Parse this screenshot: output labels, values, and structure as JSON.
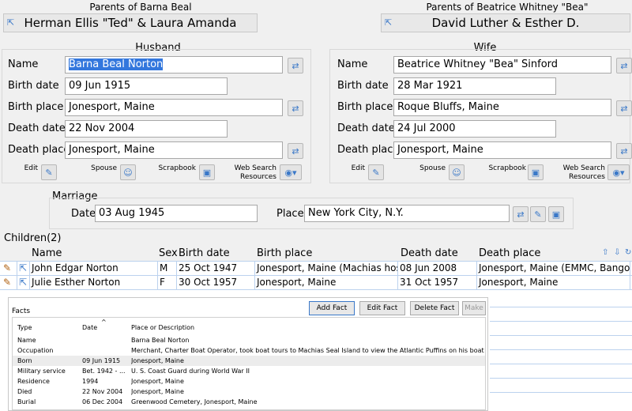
{
  "husband_parents": {
    "caption": "Parents of Barna Beal",
    "name": "Herman Ellis \"Ted\" & Laura Amanda"
  },
  "wife_parents": {
    "caption": "Parents of Beatrice Whitney \"Bea\"",
    "name": "David Luther & Esther D."
  },
  "husband": {
    "title": "Husband",
    "name_label": "Name",
    "name": "Barna Beal Norton",
    "birth_date_label": "Birth date",
    "birth_date": "09 Jun 1915",
    "birth_place_label": "Birth place",
    "birth_place": "Jonesport, Maine",
    "death_date_label": "Death date",
    "death_date": "22 Nov 2004",
    "death_place_label": "Death place",
    "death_place": "Jonesport, Maine",
    "edit_label": "Edit",
    "spouse_label": "Spouse",
    "scrapbook_label": "Scrapbook",
    "web_search_label_1": "Web Search",
    "web_search_label_2": "Resources"
  },
  "wife": {
    "title": "Wife",
    "name_label": "Name",
    "name": "Beatrice Whitney \"Bea\" Sinford",
    "birth_date_label": "Birth date",
    "birth_date": "28 Mar 1921",
    "birth_place_label": "Birth place",
    "birth_place": "Roque Bluffs, Maine",
    "death_date_label": "Death date",
    "death_date": "24 Jul 2000",
    "death_place_label": "Death place",
    "death_place": "Jonesport, Maine",
    "edit_label": "Edit",
    "spouse_label": "Spouse",
    "scrapbook_label": "Scrapbook",
    "web_search_label_1": "Web Search",
    "web_search_label_2": "Resources"
  },
  "marriage": {
    "title": "Marriage",
    "date_label": "Date",
    "date": "03 Aug 1945",
    "place_label": "Place",
    "place": "New York City, N.Y."
  },
  "children": {
    "title": "Children(2)",
    "columns": {
      "name": "Name",
      "sex": "Sex",
      "birth_date": "Birth date",
      "birth_place": "Birth place",
      "death_date": "Death date",
      "death_place": "Death place"
    },
    "rows": [
      {
        "name": "John Edgar Norton",
        "sex": "M",
        "birth_date": "25 Oct 1947",
        "birth_place": "Jonesport, Maine (Machias hospi",
        "death_date": "08 Jun 2008",
        "death_place": "Jonesport, Maine  (EMMC, Bangor)"
      },
      {
        "name": "Julie Esther Norton",
        "sex": "F",
        "birth_date": "30 Oct 1957",
        "birth_place": "Jonesport, Maine",
        "death_date": "31 Oct 1957",
        "death_place": "Jonesport, Maine"
      }
    ]
  },
  "facts": {
    "title": "Facts",
    "buttons": {
      "add": "Add Fact",
      "edit": "Edit Fact",
      "delete": "Delete Fact",
      "make": "Make"
    },
    "columns": {
      "type": "Type",
      "date": "Date",
      "place": "Place or Description"
    },
    "rows": [
      {
        "type": "Name",
        "date": "",
        "place": "Barna Beal Norton"
      },
      {
        "type": "Occupation",
        "date": "",
        "place": "Merchant, Charter Boat Operator, took boat tours to Machias Seal Island to view the Atlantic Puffins on his boat \"Chief\""
      },
      {
        "type": "Born",
        "date": "09 Jun 1915",
        "place": "Jonesport, Maine"
      },
      {
        "type": "Military service",
        "date": "Bet. 1942 - ...",
        "place": "U. S. Coast Guard during World War II"
      },
      {
        "type": "Residence",
        "date": "1994",
        "place": "Jonesport, Maine"
      },
      {
        "type": "Died",
        "date": "22 Nov 2004",
        "place": "Jonesport, Maine"
      },
      {
        "type": "Burial",
        "date": "06 Dec 2004",
        "place": "Greenwood Cemetery, Jonesport, Maine"
      }
    ]
  }
}
